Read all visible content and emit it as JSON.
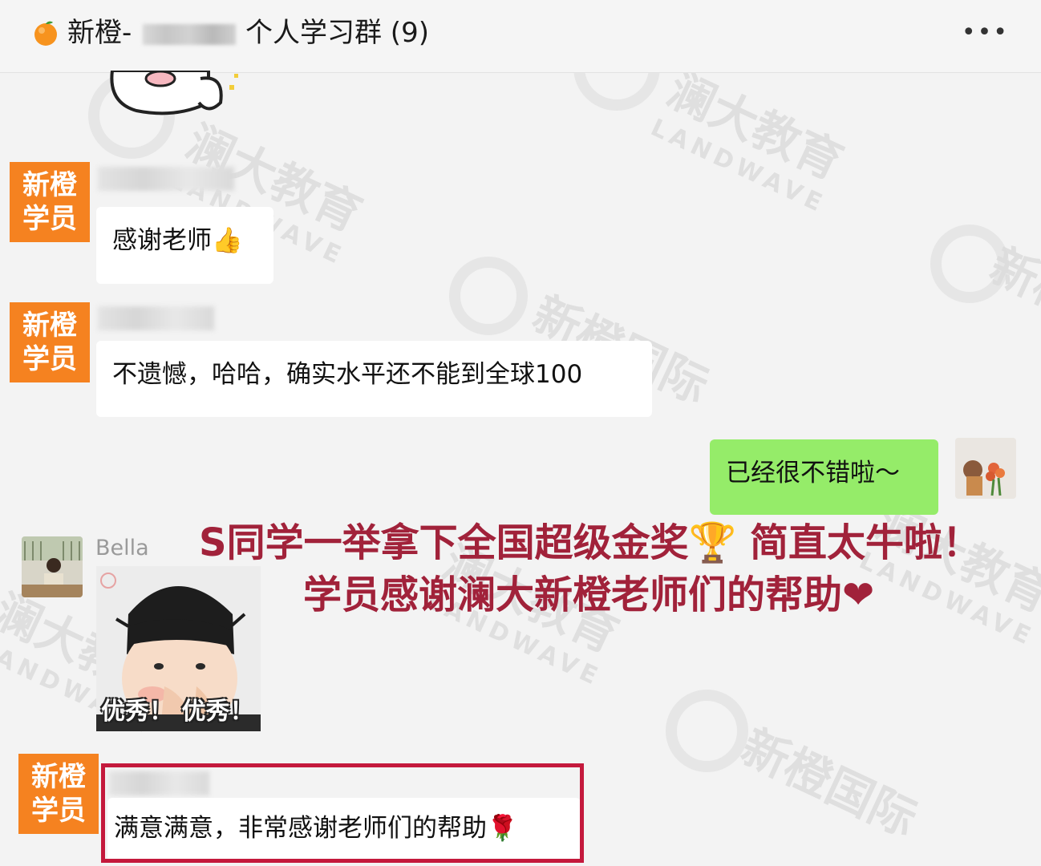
{
  "header": {
    "title_prefix": "新橙-",
    "title_suffix": "个人学习群 (9)",
    "more_label": "•••"
  },
  "watermark": {
    "brand_cn": "澜大教育",
    "brand_en": "LANDWAVE",
    "brand2_cn": "新橙国际"
  },
  "student_tag": "新橙学员",
  "messages": [
    {
      "text": "感谢老师👍"
    },
    {
      "text": "不遗憾，哈哈，确实水平还不能到全球100"
    },
    {
      "text": "已经很不错啦～"
    },
    {
      "sender": "Bella",
      "sticker_caption": "优秀！ 优秀！"
    },
    {
      "text": "满意满意，非常感谢老师们的帮助🌹"
    }
  ],
  "overlay": {
    "line1": "S同学一举拿下全国超级金奖🏆 简直太牛啦！",
    "line2": "学员感谢澜大新橙老师们的帮助❤"
  },
  "colors": {
    "student_tag_bg": "#f58220",
    "overlay_text": "#a1223a",
    "highlight_border": "#c4193c",
    "self_bubble": "#95ec69"
  }
}
